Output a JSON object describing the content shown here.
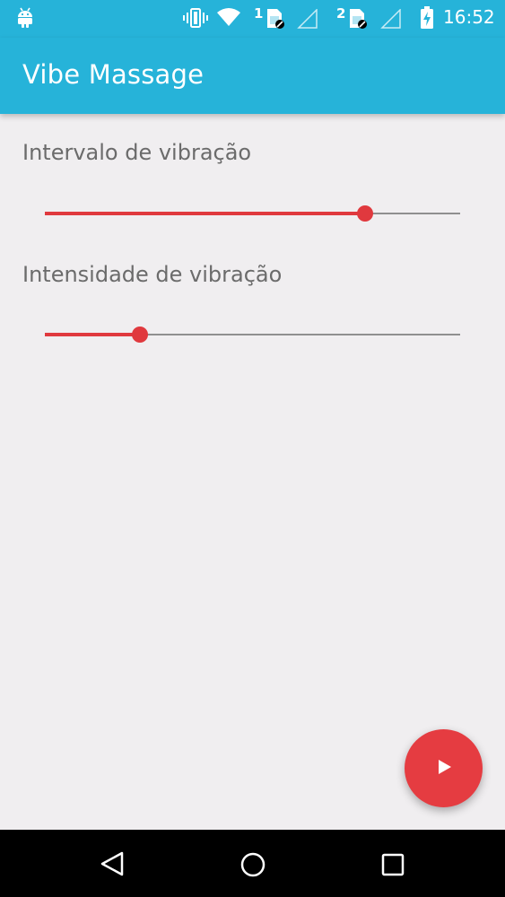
{
  "status_bar": {
    "time": "16:52",
    "sim1_label": "1",
    "sim2_label": "2",
    "icons": [
      "android-icon",
      "vibrate-icon",
      "wifi-icon",
      "sim-icon",
      "signal-icon",
      "battery-charging-icon"
    ]
  },
  "app_bar": {
    "title": "Vibe Massage"
  },
  "settings": {
    "interval": {
      "label": "Intervalo de vibração",
      "value": 0.77
    },
    "intensity": {
      "label": "Intensidade de vibração",
      "value": 0.23
    }
  },
  "fab": {
    "icon": "play-icon"
  },
  "nav_bar": {
    "icons": [
      "back-icon",
      "home-icon",
      "recents-icon"
    ]
  },
  "colors": {
    "primary": "#26b3d9",
    "accent": "#e0393e",
    "background": "#f0eef0"
  }
}
